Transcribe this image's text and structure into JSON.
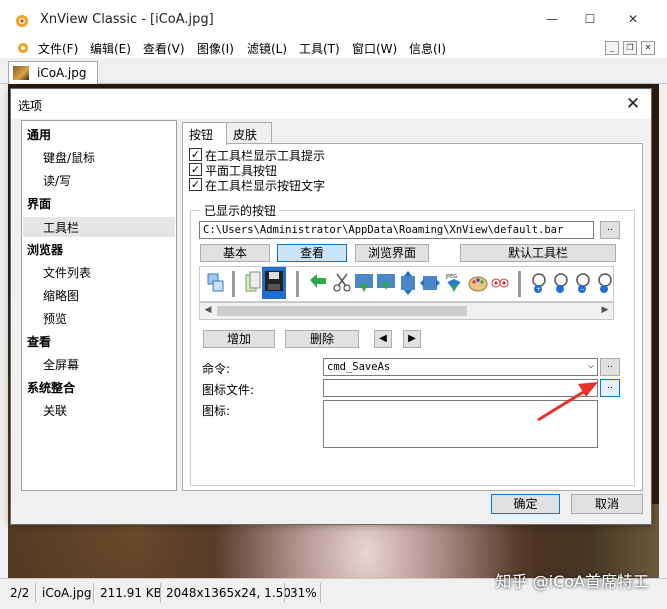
{
  "window": {
    "title": "XnView Classic - [iCoA.jpg]",
    "controls": {
      "minimize": "—",
      "maximize": "☐",
      "close": "✕"
    }
  },
  "menu": [
    "文件(F)",
    "编辑(E)",
    "查看(V)",
    "图像(I)",
    "滤镜(L)",
    "工具(T)",
    "窗口(W)",
    "信息(I)"
  ],
  "mdi_controls": [
    "_",
    "❐",
    "✕"
  ],
  "doc_tab": {
    "label": "iCoA.jpg"
  },
  "status": {
    "index": "2/2",
    "file": "iCoA.jpg",
    "size": "211.91 KB",
    "dims": "2048x1365x24, 1.50",
    "zoom": "31%"
  },
  "watermark": "知乎 @iCoA首席特工",
  "dialog": {
    "title": "选项",
    "close": "✕",
    "tree": [
      {
        "label": "通用",
        "level": 0
      },
      {
        "label": "键盘/鼠标",
        "level": 1
      },
      {
        "label": "读/写",
        "level": 1
      },
      {
        "label": "界面",
        "level": 0
      },
      {
        "label": "工具栏",
        "level": 1,
        "selected": true
      },
      {
        "label": "浏览器",
        "level": 0
      },
      {
        "label": "文件列表",
        "level": 1
      },
      {
        "label": "缩略图",
        "level": 1
      },
      {
        "label": "预览",
        "level": 1
      },
      {
        "label": "查看",
        "level": 0
      },
      {
        "label": "全屏幕",
        "level": 1
      },
      {
        "label": "系统整合",
        "level": 0
      },
      {
        "label": "关联",
        "level": 1
      }
    ],
    "tabs": [
      {
        "label": "按钮",
        "active": true
      },
      {
        "label": "皮肤",
        "active": false
      }
    ],
    "checkboxes": [
      {
        "label": "在工具栏显示工具提示",
        "checked": true
      },
      {
        "label": "平面工具按钮",
        "checked": true
      },
      {
        "label": "在工具栏显示按钮文字",
        "checked": true
      }
    ],
    "group_label": "已显示的按钮",
    "path_value": "C:\\Users\\Administrator\\AppData\\Roaming\\XnView\\default.bar",
    "browse": "..",
    "mode_buttons": [
      {
        "label": "基本",
        "selected": false
      },
      {
        "label": "查看",
        "selected": true
      },
      {
        "label": "浏览界面",
        "selected": false
      }
    ],
    "default_toolbar": "默认工具栏",
    "add_button": "增加",
    "delete_button": "删除",
    "move_left": "◀",
    "move_right": "▶",
    "command_label": "命令:",
    "command_value": "cmd_SaveAs",
    "icon_file_label": "图标文件:",
    "icon_file_value": "",
    "icon_label": "图标:",
    "ok": "确定",
    "cancel": "取消",
    "jpeg_icon_text": "JPEG",
    "annotation_color": "#e8302a"
  }
}
